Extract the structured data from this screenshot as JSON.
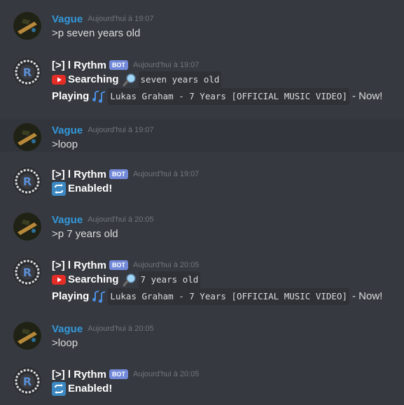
{
  "users": {
    "vague": "Vague",
    "rythm": "[>] l Rythm",
    "bot_badge": "BOT"
  },
  "messages": [
    {
      "ts": "Aujourd'hui à 19:07",
      "text": ">p seven years old"
    },
    {
      "ts": "Aujourd'hui à 19:07",
      "searching": "Searching",
      "query": "seven years old",
      "playing": "Playing",
      "track": "Lukas Graham - 7 Years [OFFICIAL MUSIC VIDEO]",
      "now": "- Now!"
    },
    {
      "ts": "Aujourd'hui à 19:07",
      "text": ">loop"
    },
    {
      "ts": "Aujourd'hui à 19:07",
      "enabled": "Enabled!"
    },
    {
      "ts": "Aujourd'hui à 20:05",
      "text": ">p 7 years old"
    },
    {
      "ts": "Aujourd'hui à 20:05",
      "searching": "Searching",
      "query": "7 years old",
      "playing": "Playing",
      "track": "Lukas Graham - 7 Years [OFFICIAL MUSIC VIDEO]",
      "now": "- Now!"
    },
    {
      "ts": "Aujourd'hui à 20:05",
      "text": ">loop"
    },
    {
      "ts": "Aujourd'hui à 20:05",
      "enabled": "Enabled!"
    }
  ],
  "colors": {
    "background": "#36393f",
    "highlight": "#32353b",
    "user_name": "#3498db",
    "bot_badge": "#7289da",
    "timestamp": "#72767d"
  },
  "icons": [
    "user-avatar",
    "rythm-avatar",
    "youtube-icon",
    "magnifier-icon",
    "music-notes-icon",
    "repeat-icon"
  ]
}
